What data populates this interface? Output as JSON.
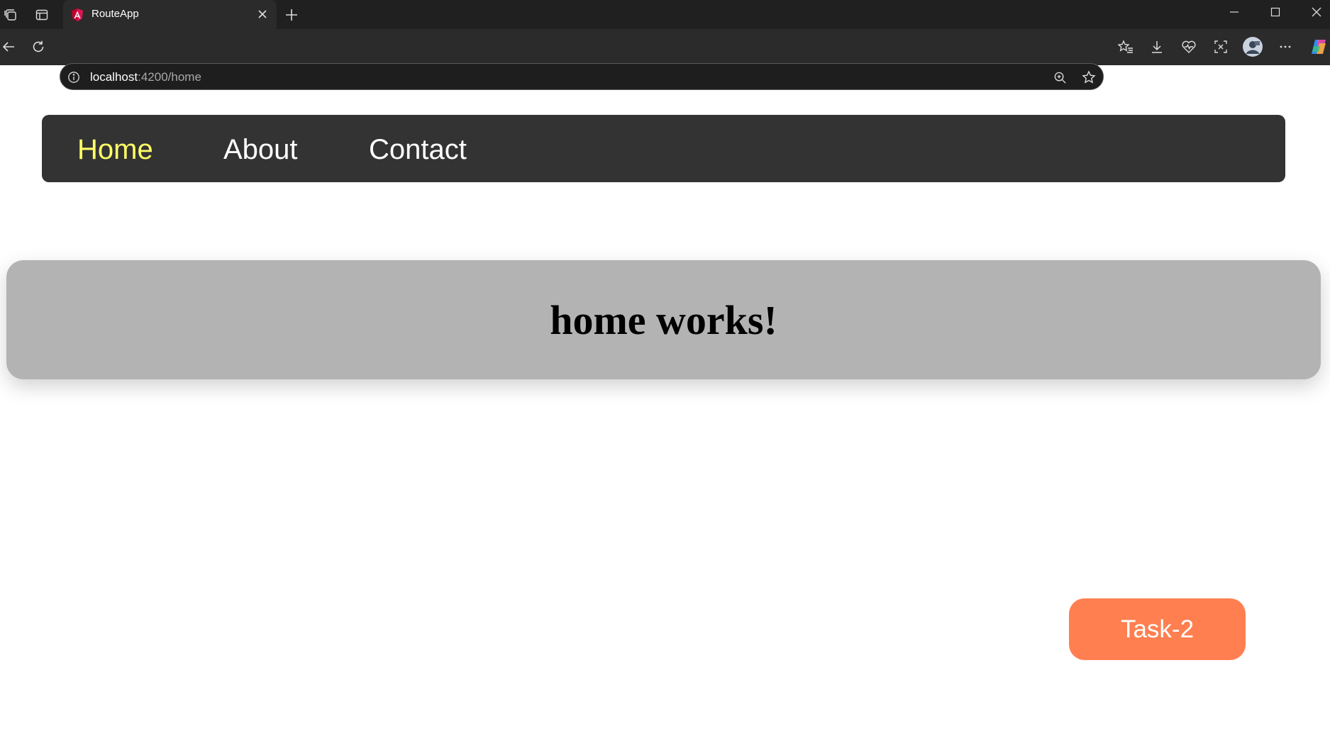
{
  "browser": {
    "tab": {
      "title": "RouteApp",
      "favicon": "angular-icon"
    },
    "address": {
      "host": "localhost",
      "path": ":4200/home"
    },
    "icons": [
      "workspaces-icon",
      "vertical-tabs-icon",
      "close-icon",
      "new-tab-icon",
      "minimize-icon",
      "maximize-icon",
      "window-close-icon",
      "back-icon",
      "refresh-icon",
      "site-info-icon",
      "zoom-icon",
      "favorite-star-icon",
      "favorites-icon",
      "downloads-icon",
      "browser-essentials-icon",
      "screenshot-icon",
      "profile-avatar",
      "more-menu-icon",
      "copilot-icon"
    ]
  },
  "nav": {
    "links": [
      {
        "label": "Home",
        "active": true
      },
      {
        "label": "About",
        "active": false
      },
      {
        "label": "Contact",
        "active": false
      }
    ]
  },
  "main": {
    "heading": "home works!"
  },
  "task_button": {
    "label": "Task-2"
  },
  "colors": {
    "navbar_bg": "#333333",
    "nav_active": "#ffff66",
    "nav_inactive": "#ffffff",
    "hero_bg": "#b3b3b3",
    "task_button_bg": "#ff7f50"
  }
}
